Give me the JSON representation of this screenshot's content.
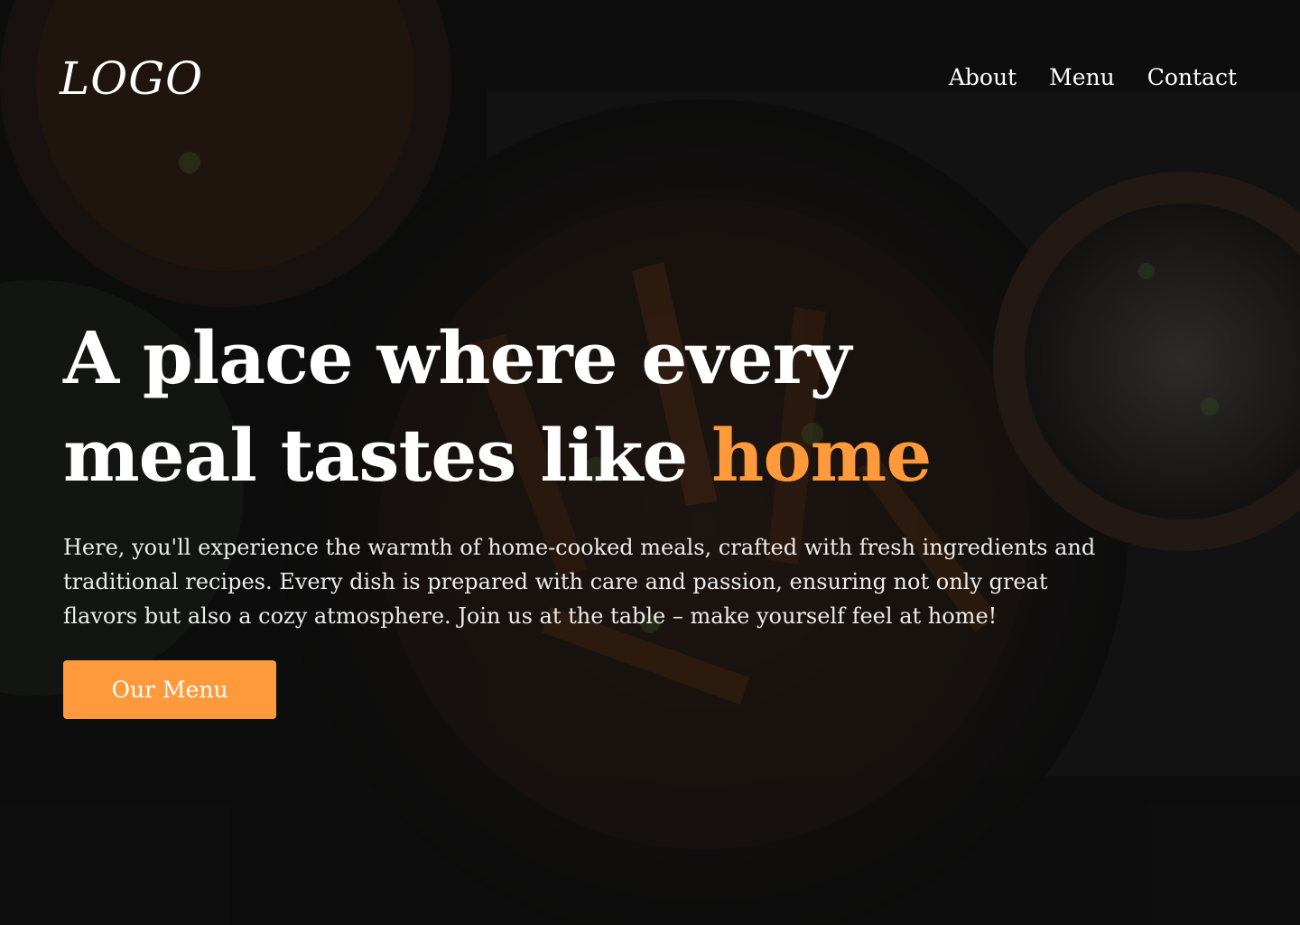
{
  "brand": {
    "logo_text": "LOGO"
  },
  "nav": {
    "items": [
      {
        "label": "About"
      },
      {
        "label": "Menu"
      },
      {
        "label": "Contact"
      }
    ]
  },
  "hero": {
    "headline_line1": "A place where every",
    "headline_line2_prefix": "meal tastes like ",
    "headline_highlight": "home",
    "description": "Here, you'll experience the warmth of home-cooked meals, crafted with fresh ingredients and traditional recipes. Every dish is prepared with care and passion, ensuring not only great flavors but also a cozy atmosphere. Join us at the table – make yourself feel at home!",
    "cta_label": "Our Menu"
  },
  "colors": {
    "accent": "#ff9a3c",
    "text": "#ffffff",
    "background_tint": "#0c0c0c"
  },
  "background": {
    "image_subject": "dark-food-photo"
  }
}
